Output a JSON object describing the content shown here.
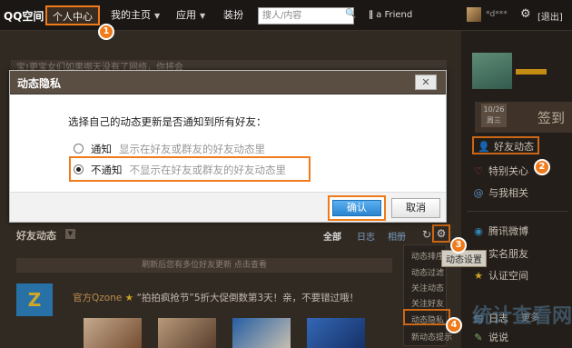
{
  "topbar": {
    "logo": "QQ空间",
    "nav": [
      "个人中心",
      "我的主页",
      "应用",
      "装扮"
    ],
    "search_placeholder": "搜人/内容",
    "friend_text": "a Friend",
    "username": "*d***",
    "logout": "[退出]"
  },
  "background": {
    "hint_text": "宝!更宝女们如果哪天没有了网络，你将会"
  },
  "dialog": {
    "title": "动态隐私",
    "question": "选择自己的动态更新是否通知到所有好友：",
    "options": [
      {
        "label": "通知",
        "desc": "显示在好友或群友的好友动态里",
        "checked": false
      },
      {
        "label": "不通知",
        "desc": "不显示在好友或群友的好友动态里",
        "checked": true
      }
    ],
    "confirm": "确认",
    "cancel": "取消"
  },
  "sidebar": {
    "date_top": "10/26",
    "date_bottom": "周三",
    "checkin": "签到",
    "items": [
      {
        "icon": "person-icon",
        "label": "好友动态"
      },
      {
        "icon": "heart-icon",
        "label": "特别关心"
      },
      {
        "icon": "at-icon",
        "label": "与我相关"
      },
      {
        "icon": "weibo-icon",
        "label": "腾讯微博"
      },
      {
        "icon": "people-icon",
        "label": "实名朋友"
      },
      {
        "icon": "star-icon",
        "label": "认证空间"
      },
      {
        "icon": "diary-icon",
        "label": "日志"
      },
      {
        "icon": "talk-icon",
        "label": "说说"
      }
    ],
    "more": "更多"
  },
  "feed": {
    "title": "好友动态",
    "tabs": [
      "全部",
      "日志",
      "相册"
    ],
    "settings_tooltip": "动态设置",
    "dropdown": [
      "动态排序",
      "动态过滤",
      "关注动态",
      "关注好友",
      "动态隐私",
      "新动态提示"
    ],
    "notice": "刷新后您有多位好友更新 点击查看",
    "post_user": "官方Qzone",
    "post_text": "“拍拍疯抢节”5折大促倒数第3天！亲，不要错过哦！",
    "post_avatar": "Z"
  },
  "callouts": [
    "1",
    "2",
    "3",
    "4"
  ],
  "watermark": "统计查看网",
  "colors": {
    "accent": "#f07a1a",
    "confirm_blue": "#2a84d0"
  }
}
